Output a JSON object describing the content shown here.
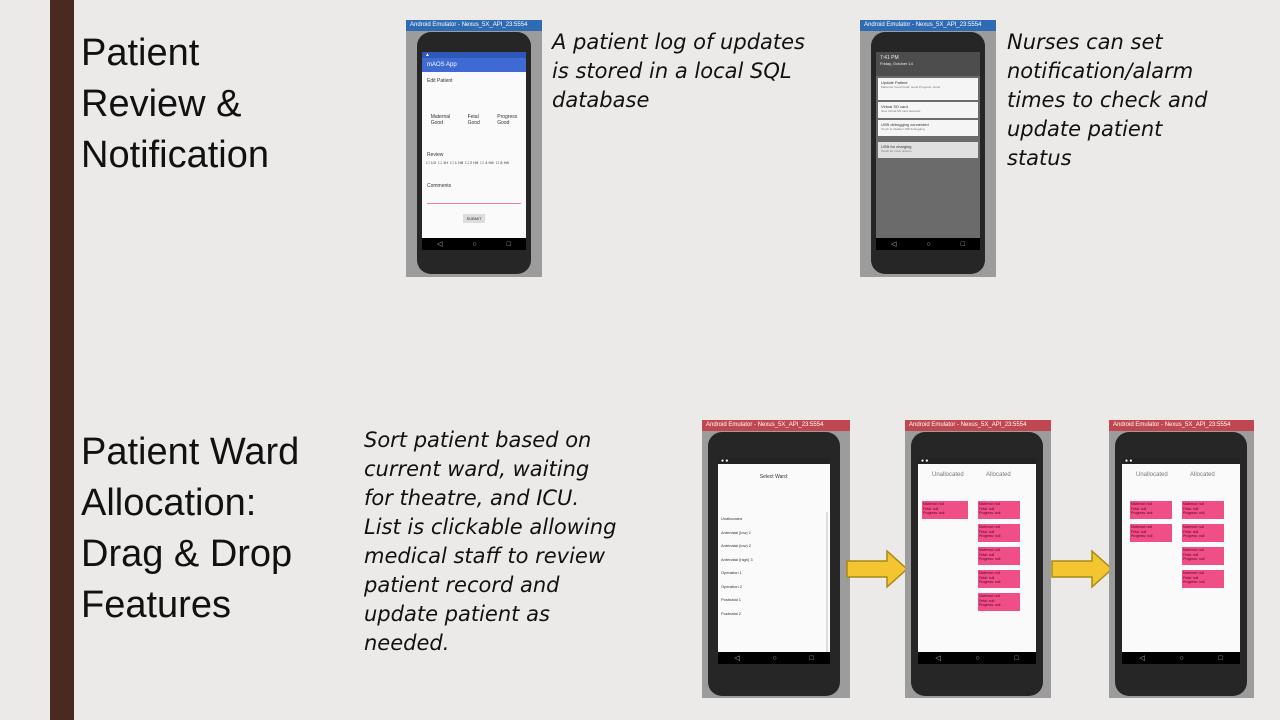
{
  "slide": {
    "section1_title": "Patient\nReview &\nNotification",
    "section2_title": "Patient Ward\nAllocation:\nDrag & Drop\nFeatures",
    "note_log": "A patient log of updates\nis stored in a local SQL\ndatabase",
    "note_nurse": "Nurses can set\nnotification/alarm\ntimes to check and\nupdate patient\nstatus",
    "note_sort": "Sort patient based on\ncurrent ward, waiting\nfor theatre, and ICU.\nList is clickable allowing\nmedical staff to review\npatient record and\nupdate patient as\nneeded."
  },
  "emulator_title": "Android Emulator - Nexus_5X_API_23:5554",
  "phone1": {
    "app_name": "mAOS App",
    "form_title": "Edit Patient",
    "fields": [
      "Maternal",
      "Fetal",
      "Progress"
    ],
    "selects": [
      "Good",
      "Good",
      "Good"
    ],
    "review_label": "Review",
    "review_options": [
      "1/2",
      "1H",
      "1 H8",
      "2 H8",
      "4 H8",
      "8 H8"
    ],
    "comments_label": "Comments",
    "submit_label": "SUBMIT"
  },
  "phone2": {
    "time": "7:41 PM",
    "date": "Friday, October 14",
    "notifications": [
      {
        "title": "Update Patient",
        "body": "Maternal: Good  Fetal: Good  Progress: Good"
      },
      {
        "title": "Virtual SD card",
        "body": "New Virtual SD card detected"
      },
      {
        "title": "USB debugging connected",
        "body": "Touch to disable USB debugging"
      },
      {
        "title": "USB for charging",
        "body": "Touch for more options"
      }
    ]
  },
  "phone3": {
    "heading": "Select Ward:",
    "wards": [
      "Unallocated",
      "Antenatal (low) 1",
      "Antenatal (low) 2",
      "Antenatal (high) 3",
      "Operation 1",
      "Operation 2",
      "Postnatal 1",
      "Postnatal 2"
    ]
  },
  "phone4": {
    "col_unallocated": "Unallocated",
    "col_allocated": "Allocated",
    "card_lines": [
      "Maternal: null",
      "Fetal: null",
      "Progress: null"
    ]
  },
  "phone5": {
    "col_unallocated": "Unallocated",
    "col_allocated": "Allocated"
  },
  "nav": {
    "back": "◁",
    "home": "○",
    "recent": "□"
  }
}
